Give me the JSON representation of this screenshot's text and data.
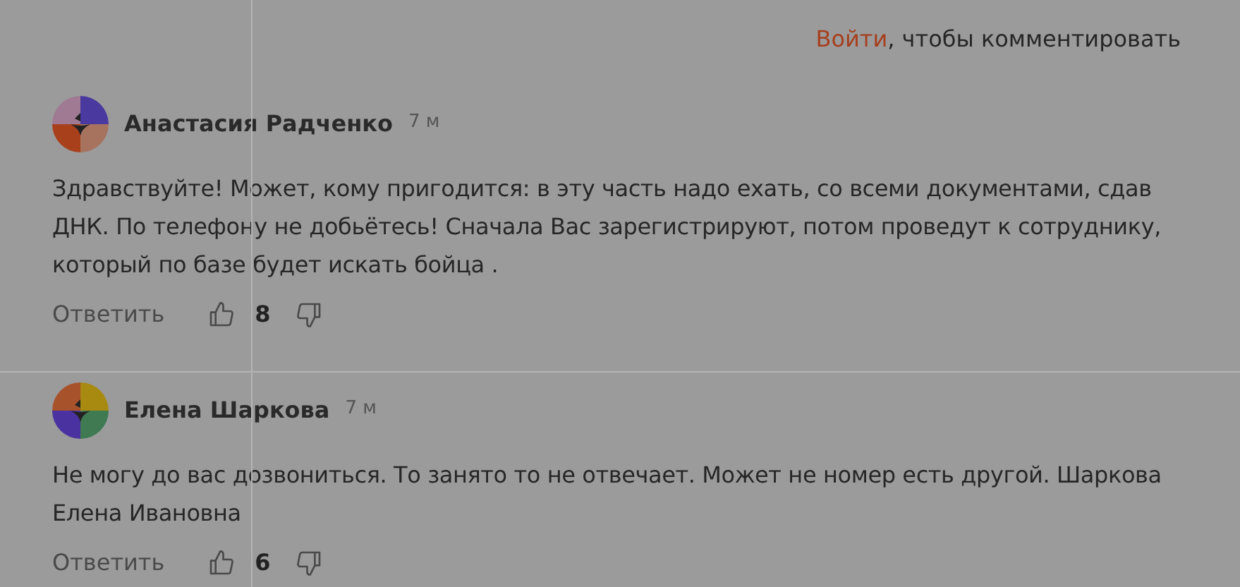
{
  "login_prompt": {
    "link": "Войти",
    "text": ", чтобы комментировать"
  },
  "comments": [
    {
      "author": "Анастасия Радченко",
      "time": "7 м",
      "text": "Здравствуйте! Может, кому пригодится: в эту часть надо ехать, со всеми документами, сдав ДНК. По телефону не добьётесь! Сначала Вас зарегистрируют, потом проведут к сотруднику, который по базе будет искать бойца .",
      "reply": "Ответить",
      "likes": "8"
    },
    {
      "author": "Елена Шаркова",
      "time": "7 м",
      "text": "Не могу до вас дозвониться. То занято то не отвечает. Может не номер есть другой. Шаркова Елена Ивановна",
      "reply": "Ответить",
      "likes": "6"
    }
  ]
}
